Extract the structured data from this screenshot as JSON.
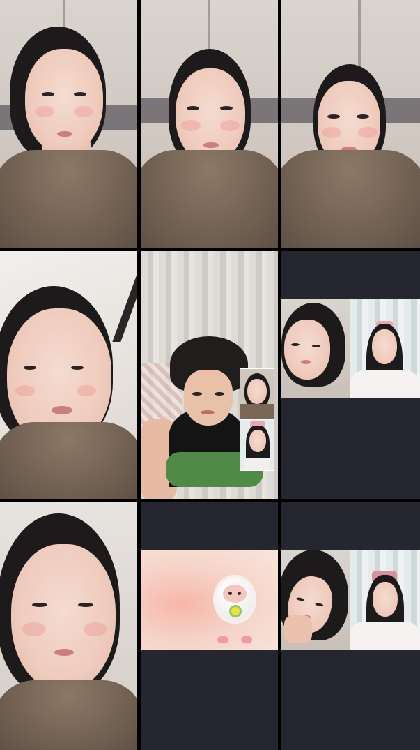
{
  "grid": {
    "tiles": [
      {
        "id": "tile-1",
        "type": "camera-feed"
      },
      {
        "id": "tile-2",
        "type": "camera-feed"
      },
      {
        "id": "tile-3",
        "type": "camera-feed"
      },
      {
        "id": "tile-4",
        "type": "camera-feed"
      },
      {
        "id": "tile-5",
        "type": "camera-feed-with-pip"
      },
      {
        "id": "tile-6",
        "type": "split-screen-feed"
      },
      {
        "id": "tile-7",
        "type": "camera-feed"
      },
      {
        "id": "tile-8",
        "type": "sticker-avatar"
      },
      {
        "id": "tile-9",
        "type": "split-screen-feed"
      }
    ]
  },
  "colors": {
    "background": "#000000",
    "empty_tile": "#25262f",
    "sweater": "#6f5f51",
    "hair": "#1d1a1b",
    "pink_stage": "#f7b6a8"
  },
  "icons": {
    "sticker": "sheep-avatar"
  }
}
